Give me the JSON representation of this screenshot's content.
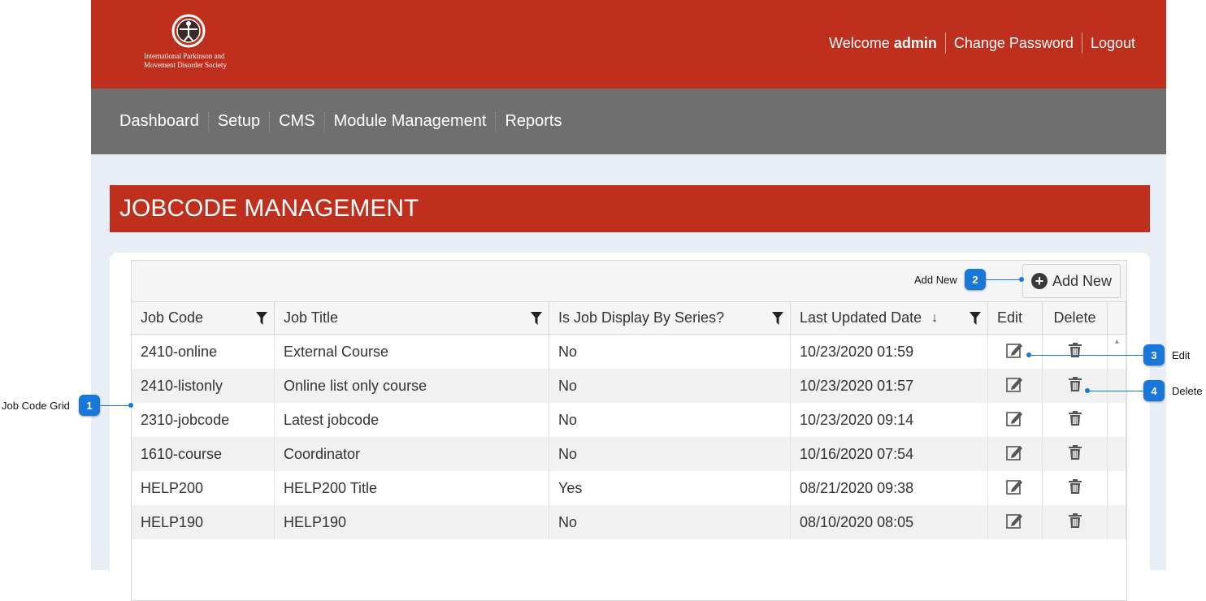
{
  "brand": {
    "org_line1": "International Parkinson and",
    "org_line2": "Movement Disorder Society"
  },
  "header": {
    "welcome_prefix": "Welcome",
    "username": "admin",
    "change_password": "Change Password",
    "logout": "Logout"
  },
  "nav": [
    "Dashboard",
    "Setup",
    "CMS",
    "Module Management",
    "Reports"
  ],
  "page_title": "JOBCODE MANAGEMENT",
  "toolbar": {
    "add_new": "Add New"
  },
  "columns": [
    "Job Code",
    "Job Title",
    "Is Job Display By Series?",
    "Last Updated Date",
    "Edit",
    "Delete"
  ],
  "rows": [
    {
      "code": "2410-online",
      "title": "External Course",
      "series": "No",
      "updated": "10/23/2020 01:59"
    },
    {
      "code": "2410-listonly",
      "title": "Online list only course",
      "series": "No",
      "updated": "10/23/2020 01:57"
    },
    {
      "code": "2310-jobcode",
      "title": "Latest jobcode",
      "series": "No",
      "updated": "10/23/2020 09:14"
    },
    {
      "code": "1610-course",
      "title": "Coordinator",
      "series": "No",
      "updated": "10/16/2020 07:54"
    },
    {
      "code": "HELP200",
      "title": "HELP200 Title",
      "series": "Yes",
      "updated": "08/21/2020 09:38"
    },
    {
      "code": "HELP190",
      "title": "HELP190",
      "series": "No",
      "updated": "08/10/2020 08:05"
    }
  ],
  "callouts": [
    {
      "number": "1",
      "label": "Job Code Grid"
    },
    {
      "number": "2",
      "label": "Add New"
    },
    {
      "number": "3",
      "label": "Edit"
    },
    {
      "number": "4",
      "label": "Delete"
    }
  ],
  "colors": {
    "header_red": "#be2f1d",
    "nav_gray": "#6f6f6f",
    "callout_blue": "#1877d8",
    "page_bg": "#e9eef6"
  }
}
